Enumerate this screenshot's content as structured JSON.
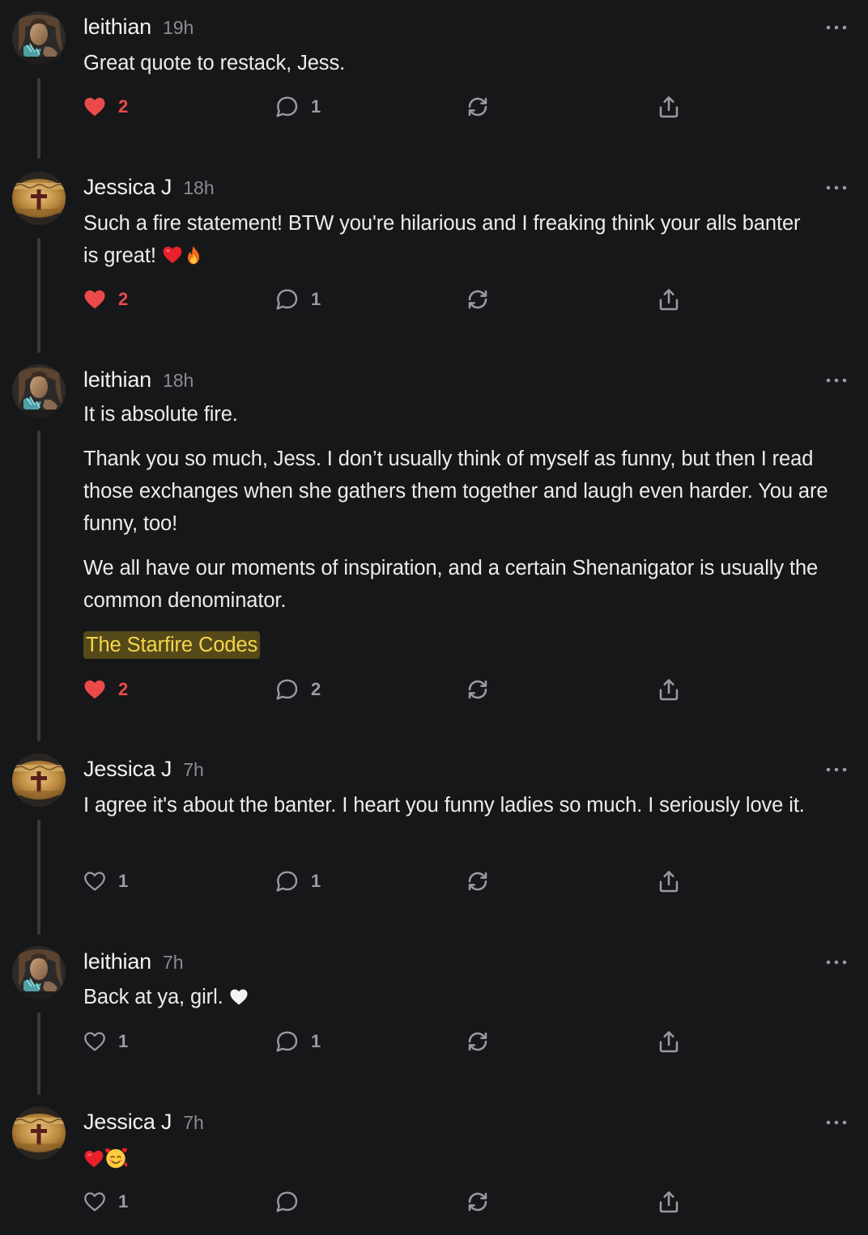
{
  "colors": {
    "background": "#161719",
    "like_active": "#ec4a4a",
    "icon": "#9a9aa0",
    "highlight_bg": "#55491a",
    "highlight_text": "#f6d64a"
  },
  "comments": [
    {
      "author": "leithian",
      "time": "19h",
      "avatar": "leithian-avatar",
      "paragraphs": [
        "Great quote to restack, Jess."
      ],
      "liked": true,
      "likes": "2",
      "replies": "1"
    },
    {
      "author": "Jessica J",
      "time": "18h",
      "avatar": "jessica-avatar",
      "paragraphs": [
        "Such a fire statement! BTW you're hilarious and I freaking think your alls banter is great!"
      ],
      "emojis": [
        "red-heart",
        "fire"
      ],
      "liked": true,
      "likes": "2",
      "replies": "1"
    },
    {
      "author": "leithian",
      "time": "18h",
      "avatar": "leithian-avatar",
      "paragraphs": [
        "It is absolute fire.",
        "Thank you so much, Jess. I don’t usually think of myself as funny, but then I read those exchanges when she gathers them together and laugh even harder. You are funny, too!",
        "We all have our moments of inspiration, and a certain Shenanigator is usually the common denominator."
      ],
      "tag": "The Starfire Codes",
      "liked": true,
      "likes": "2",
      "replies": "2"
    },
    {
      "author": "Jessica J",
      "time": "7h",
      "avatar": "jessica-avatar",
      "paragraphs": [
        "I agree it's about the banter. I heart you funny ladies so much. I seriously love it."
      ],
      "liked": false,
      "likes": "1",
      "replies": "1"
    },
    {
      "author": "leithian",
      "time": "7h",
      "avatar": "leithian-avatar",
      "paragraphs": [
        "Back at ya, girl."
      ],
      "emojis": [
        "white-heart"
      ],
      "liked": false,
      "likes": "1",
      "replies": "1"
    },
    {
      "author": "Jessica J",
      "time": "7h",
      "avatar": "jessica-avatar",
      "paragraphs": [],
      "emojis": [
        "red-heart",
        "smiling-face-with-hearts"
      ],
      "liked": false,
      "likes": "1",
      "replies": ""
    }
  ],
  "icons": {
    "like": "heart-icon",
    "reply": "comment-bubble-icon",
    "restack": "restack-icon",
    "share": "share-icon",
    "more": "more-dots-icon"
  }
}
